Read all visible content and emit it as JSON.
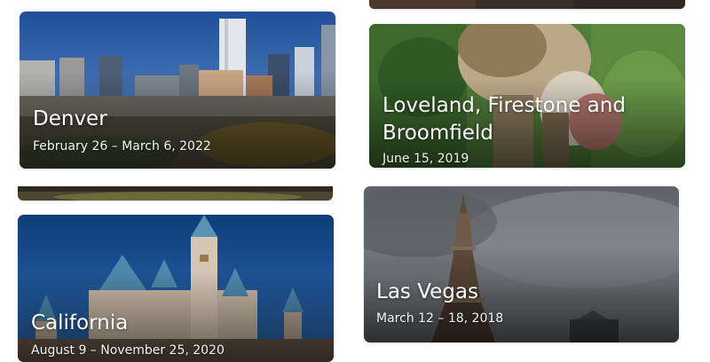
{
  "albums": [
    {
      "title": "Denver",
      "dates": "February 26 – March 6, 2022"
    },
    {
      "title": "Loveland, Firestone and Broomfield",
      "dates": "June 15, 2019"
    },
    {
      "title": "California",
      "dates": "August 9 – November 25, 2020"
    },
    {
      "title": "Las Vegas",
      "dates": "March 12 – 18, 2018"
    }
  ]
}
